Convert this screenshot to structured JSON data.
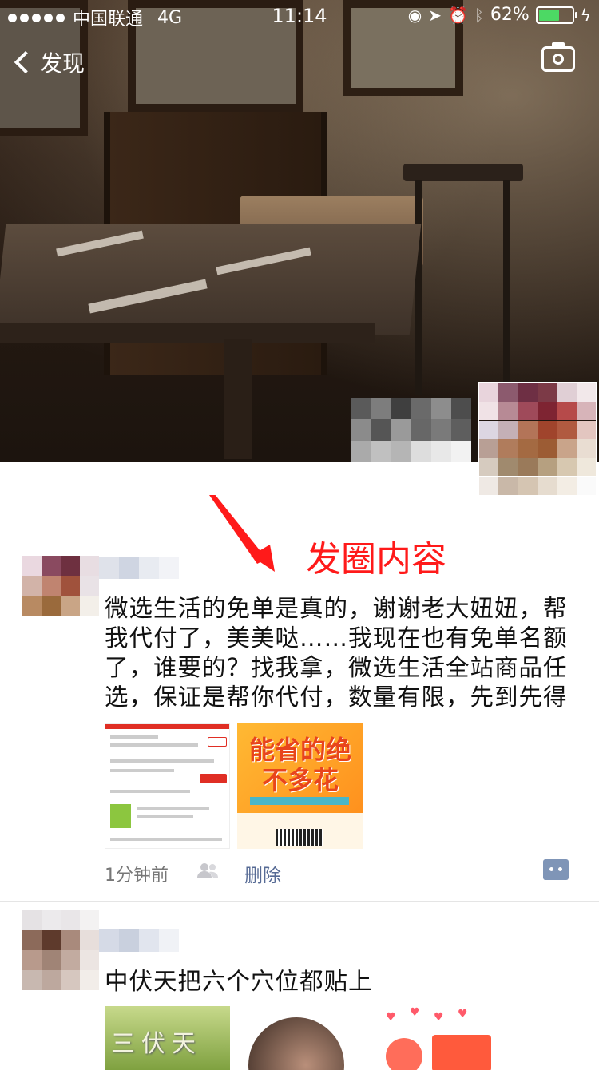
{
  "status_bar": {
    "carrier": "中国联通",
    "network": "4G",
    "time": "11:14",
    "battery_percent": "62%",
    "battery_level": 0.62
  },
  "nav": {
    "back_label": "发现"
  },
  "annotation": {
    "label": "发圈内容",
    "color": "#ff1a1a"
  },
  "posts": [
    {
      "text": "微选生活的免单是真的，谢谢老大妞妞，帮我代付了，美美哒……我现在也有免单名额了，谁要的？找我拿，微选生活全站商品任选，保证是帮你代付，数量有限，先到先得",
      "images": [
        {
          "kind": "order-screenshot"
        },
        {
          "kind": "promo-poster",
          "headline": "能省的绝不多花"
        }
      ],
      "time_ago": "1分钟前",
      "delete_label": "删除"
    },
    {
      "text": "中伏天把六个穴位都贴上",
      "images": [
        {
          "kind": "sanfu-banner",
          "headline": "三伏天"
        },
        {
          "kind": "portrait"
        },
        {
          "kind": "promo-graphic"
        }
      ]
    }
  ],
  "colors": {
    "link": "#576b95",
    "battery_fill": "#4cd964"
  }
}
